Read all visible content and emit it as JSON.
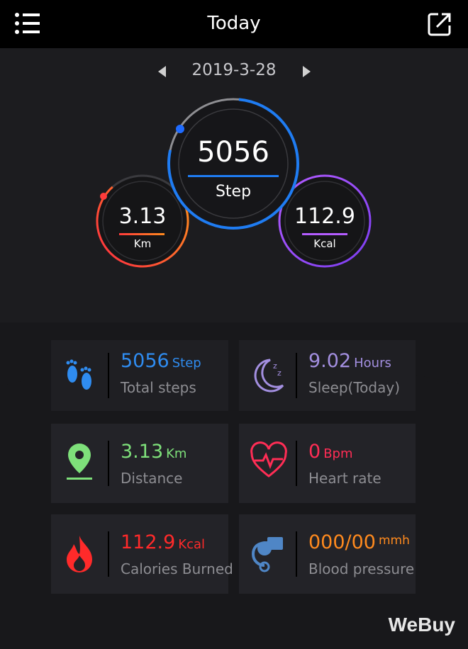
{
  "header": {
    "title": "Today"
  },
  "date": {
    "value": "2019-3-28"
  },
  "rings": {
    "step": {
      "value": "5056",
      "label": "Step"
    },
    "distance": {
      "value": "3.13",
      "label": "Km"
    },
    "calories": {
      "value": "112.9",
      "label": "Kcal"
    }
  },
  "cards": {
    "steps": {
      "value": "5056",
      "unit": "Step",
      "label": "Total steps",
      "color": "#2f8cf0"
    },
    "sleep": {
      "value": "9.02",
      "unit": "Hours",
      "label": "Sleep(Today)",
      "color": "#a38fe0"
    },
    "distance": {
      "value": "3.13",
      "unit": "Km",
      "label": "Distance",
      "color": "#7ee07a"
    },
    "heart": {
      "value": "0",
      "unit": "Bpm",
      "label": "Heart rate",
      "color": "#ff2d55"
    },
    "calories": {
      "value": "112.9",
      "unit": "Kcal",
      "label": "Calories Burned",
      "color": "#ff2a2a"
    },
    "pressure": {
      "value": "000/00",
      "unit": "mmh",
      "label": "Blood pressure",
      "color": "#ff8a1e"
    }
  },
  "watermark": "WeBuy"
}
